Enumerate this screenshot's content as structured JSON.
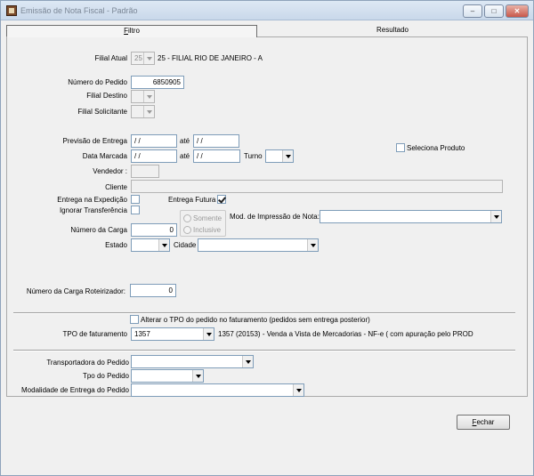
{
  "window": {
    "title": "Emissão de Nota Fiscal  -  Padrão"
  },
  "tabs": {
    "filtro": "Filtro",
    "resultado": "Resultado"
  },
  "form": {
    "filial_atual": {
      "label": "Filial Atual",
      "code": "25",
      "name": "25 - FILIAL RIO DE JANEIRO - A"
    },
    "numero_pedido": {
      "label": "Número do Pedido",
      "value": "6850905"
    },
    "filial_destino": {
      "label": "Filial Destino"
    },
    "filial_solicitante": {
      "label": "Filial Solicitante"
    },
    "previsao_entrega": {
      "label": "Previsão de Entrega",
      "from": " / /",
      "ate": "até",
      "to": " / /"
    },
    "data_marcada": {
      "label": "Data Marcada",
      "from": " / /",
      "ate": "até",
      "to": " / /",
      "turno_label": "Turno"
    },
    "seleciona_produto": {
      "label": "Seleciona Produto"
    },
    "vendedor": {
      "label": "Vendedor :"
    },
    "cliente": {
      "label": "Cliente"
    },
    "entrega_expedicao": {
      "label": "Entrega na Expedição"
    },
    "entrega_futura": {
      "label": "Entrega Futura",
      "checked": true
    },
    "ignorar_transferencia": {
      "label": "Ignorar Transferência"
    },
    "somente": "Somente",
    "inclusive": "Inclusive",
    "mod_impressao": {
      "label": "Mod. de Impressão de Nota:"
    },
    "numero_carga": {
      "label": "Número da Carga",
      "value": "0"
    },
    "estado": {
      "label": "Estado"
    },
    "cidade": {
      "label": "Cidade"
    },
    "numero_carga_roteirizador": {
      "label": "Número da Carga Roteirizador:",
      "value": "0"
    },
    "alterar_tpo": {
      "label": "Alterar o TPO do pedido no faturamento (pedidos sem entrega posterior)"
    },
    "tpo_faturamento": {
      "label": "TPO de faturamento",
      "value": "1357",
      "description": "1357 (20153) - Venda a Vista de Mercadorias - NF-e ( com apuração pelo PROD"
    },
    "transportadora": {
      "label": "Transportadora do Pedido"
    },
    "tipo_pedido": {
      "label": "Tpo do Pedido"
    },
    "modalidade_entrega": {
      "label": "Modalidade de Entrega do Pedido"
    }
  },
  "buttons": {
    "fechar": "Fechar"
  },
  "colors": {
    "accent_border": "#7f9db9",
    "title_text": "#7b8796"
  }
}
